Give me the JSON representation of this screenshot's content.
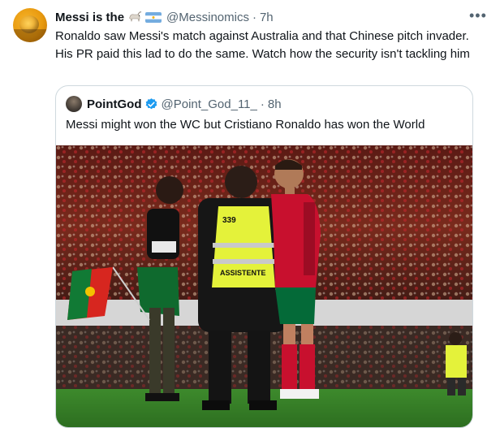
{
  "tweet": {
    "display_name": "Messi is the",
    "emoji_1": "goat-emoji",
    "emoji_2": "argentina-flag-emoji",
    "handle": "@Messinomics",
    "separator": "·",
    "time": "7h",
    "more_label": "•••",
    "text": "Ronaldo saw Messi's match against Australia and that Chinese pitch invader. His PR paid this lad to do the same. Watch how the security isn't tackling him"
  },
  "quoted_tweet": {
    "display_name": "PointGod",
    "handle": "@Point_God_11_",
    "separator": "·",
    "time": "8h",
    "text": "Messi might won the WC but Cristiano Ronaldo has won the World",
    "media": {
      "steward_number": "339",
      "steward_vest_text": "ASSISTENTE"
    }
  },
  "colors": {
    "verified_blue": "#1d9bf0",
    "muted_text": "#536471",
    "vest_yellow": "#e4f23a",
    "portugal_red": "#c8102e",
    "portugal_green": "#046a38"
  }
}
